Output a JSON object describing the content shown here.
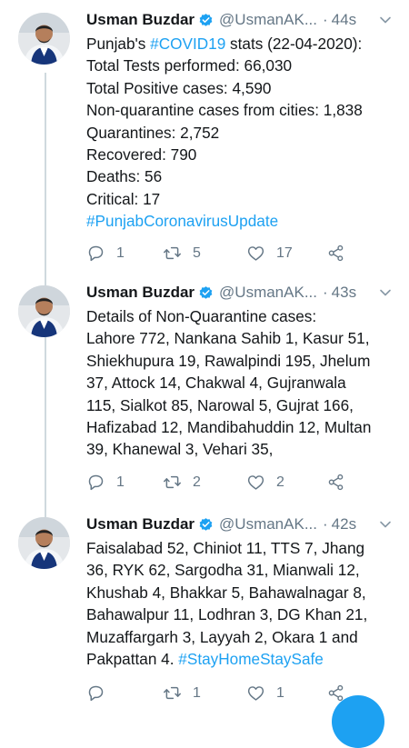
{
  "tweets": [
    {
      "author": "Usman Buzdar",
      "handle": "@UsmanAK...",
      "time": "44s",
      "lines": [
        {
          "pre": "Punjab's ",
          "tag": "#COVID19",
          "post": " stats (22-04-2020):"
        },
        {
          "pre": "Total Tests performed: 66,030"
        },
        {
          "pre": "Total Positive cases: 4,590"
        },
        {
          "pre": "Non-quarantine cases from cities: 1,838"
        },
        {
          "pre": "Quarantines: 2,752"
        },
        {
          "pre": "Recovered: 790"
        },
        {
          "pre": "Deaths: 56"
        },
        {
          "pre": "Critical: 17"
        },
        {
          "tag": "#PunjabCoronavirusUpdate"
        }
      ],
      "replies": "1",
      "retweets": "5",
      "likes": "17"
    },
    {
      "author": "Usman Buzdar",
      "handle": "@UsmanAK...",
      "time": "43s",
      "lines": [
        {
          "pre": "Details of Non-Quarantine cases:"
        },
        {
          "pre": "Lahore 772, Nankana Sahib 1, Kasur 51,"
        },
        {
          "pre": "Shiekhupura 19, Rawalpindi 195, Jhelum"
        },
        {
          "pre": "37, Attock 14, Chakwal 4, Gujranwala"
        },
        {
          "pre": "115, Sialkot 85, Narowal 5, Gujrat 166,"
        },
        {
          "pre": "Hafizabad 12, Mandibahuddin 12, Multan"
        },
        {
          "pre": "39, Khanewal 3, Vehari 35,"
        }
      ],
      "replies": "1",
      "retweets": "2",
      "likes": "2"
    },
    {
      "author": "Usman Buzdar",
      "handle": "@UsmanAK...",
      "time": "42s",
      "lines": [
        {
          "pre": "Faisalabad 52, Chiniot 11, TTS 7, Jhang"
        },
        {
          "pre": "36, RYK 62, Sargodha 31, Mianwali 12,"
        },
        {
          "pre": "Khushab 4, Bhakkar 5, Bahawalnagar 8,"
        },
        {
          "pre": "Bahawalpur 11, Lodhran 3, DG Khan 21,"
        },
        {
          "pre": "Muzaffargarh 3, Layyah 2, Okara 1 and"
        },
        {
          "pre": "Pakpattan 4. ",
          "tag": "#StayHomeStaySafe"
        }
      ],
      "replies": "",
      "retweets": "1",
      "likes": "1"
    }
  ],
  "colors": {
    "accent": "#1da1f2",
    "text": "#14171a",
    "muted": "#657786",
    "thread_line": "#cfd9de"
  },
  "icons": {
    "verified": "verified-badge-icon",
    "menu": "chevron-down-icon",
    "reply": "reply-icon",
    "retweet": "retweet-icon",
    "like": "heart-icon",
    "share": "share-icon",
    "compose": "compose-fab"
  }
}
